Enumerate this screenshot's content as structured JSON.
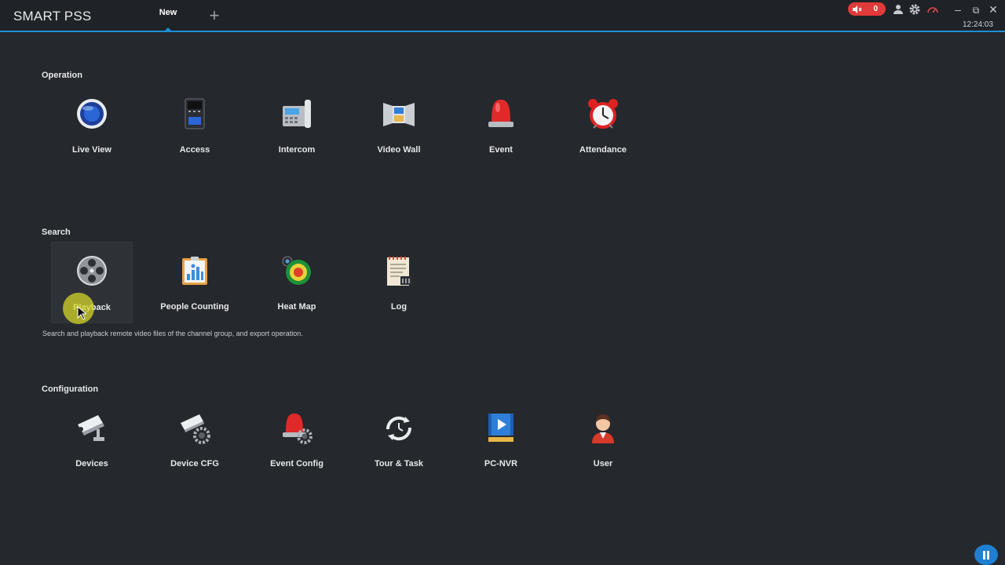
{
  "app": {
    "title": "SMART PSS",
    "clock": "12:24:03"
  },
  "tabs": [
    {
      "label": "New",
      "active": true
    }
  ],
  "header": {
    "alarm_count": "0"
  },
  "sections": [
    {
      "title": "Operation",
      "items": [
        {
          "label": "Live View",
          "icon": "camera-lens-icon"
        },
        {
          "label": "Access",
          "icon": "access-panel-icon"
        },
        {
          "label": "Intercom",
          "icon": "intercom-phone-icon"
        },
        {
          "label": "Video Wall",
          "icon": "video-wall-icon"
        },
        {
          "label": "Event",
          "icon": "alarm-light-icon"
        },
        {
          "label": "Attendance",
          "icon": "alarm-clock-icon"
        }
      ]
    },
    {
      "title": "Search",
      "items": [
        {
          "label": "Playback",
          "icon": "film-reel-icon"
        },
        {
          "label": "People Counting",
          "icon": "people-chart-icon"
        },
        {
          "label": "Heat Map",
          "icon": "heat-map-icon"
        },
        {
          "label": "Log",
          "icon": "log-document-icon"
        }
      ],
      "description": "Search and playback remote video files of the channel group, and export operation."
    },
    {
      "title": "Configuration",
      "items": [
        {
          "label": "Devices",
          "icon": "cctv-camera-icon"
        },
        {
          "label": "Device CFG",
          "icon": "camera-gear-icon"
        },
        {
          "label": "Event Config",
          "icon": "alarm-gear-icon"
        },
        {
          "label": "Tour & Task",
          "icon": "tour-cycle-icon"
        },
        {
          "label": "PC-NVR",
          "icon": "pc-nvr-icon"
        },
        {
          "label": "User",
          "icon": "user-avatar-icon"
        }
      ]
    }
  ],
  "colors": {
    "accent": "#1c8fd6",
    "alarm": "#e03a3a",
    "background": "#25282c"
  }
}
